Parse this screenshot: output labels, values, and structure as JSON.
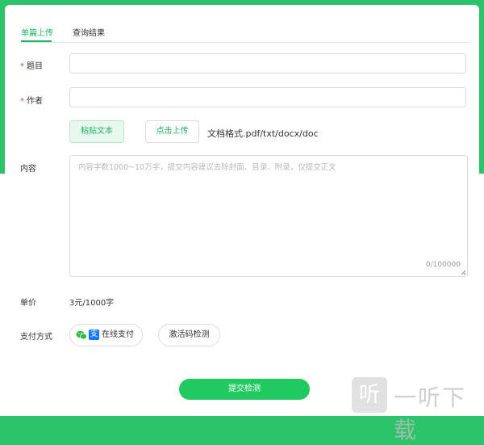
{
  "tabs": {
    "upload": "单篇上传",
    "results": "查询结果"
  },
  "form": {
    "title_label": "题目",
    "author_label": "作者",
    "required_mark": "*",
    "paste_button": "粘贴文本",
    "upload_button": "点击上传",
    "formats": "文档格式.pdf/txt/docx/doc",
    "content_label": "内容",
    "content_placeholder": "内容字数1000~10万字，提交内容建议去除封面、目录、附录，仅提交正文",
    "char_counter": "0/100000",
    "price_label": "单价",
    "price_value": "3元/1000字",
    "payment_label": "支付方式",
    "online_pay": "在线支付",
    "alipay_glyph": "支",
    "activation_code": "激活码检测",
    "submit": "提交检测"
  },
  "watermark": {
    "icon_glyph": "听",
    "text": "一听下载"
  },
  "colors": {
    "accent": "#1eb561",
    "submit": "#21c961",
    "alipay": "#1677ff",
    "required": "#e74c3c"
  },
  "icons": [
    "wechat-icon",
    "alipay-icon",
    "resize-handle-icon"
  ]
}
